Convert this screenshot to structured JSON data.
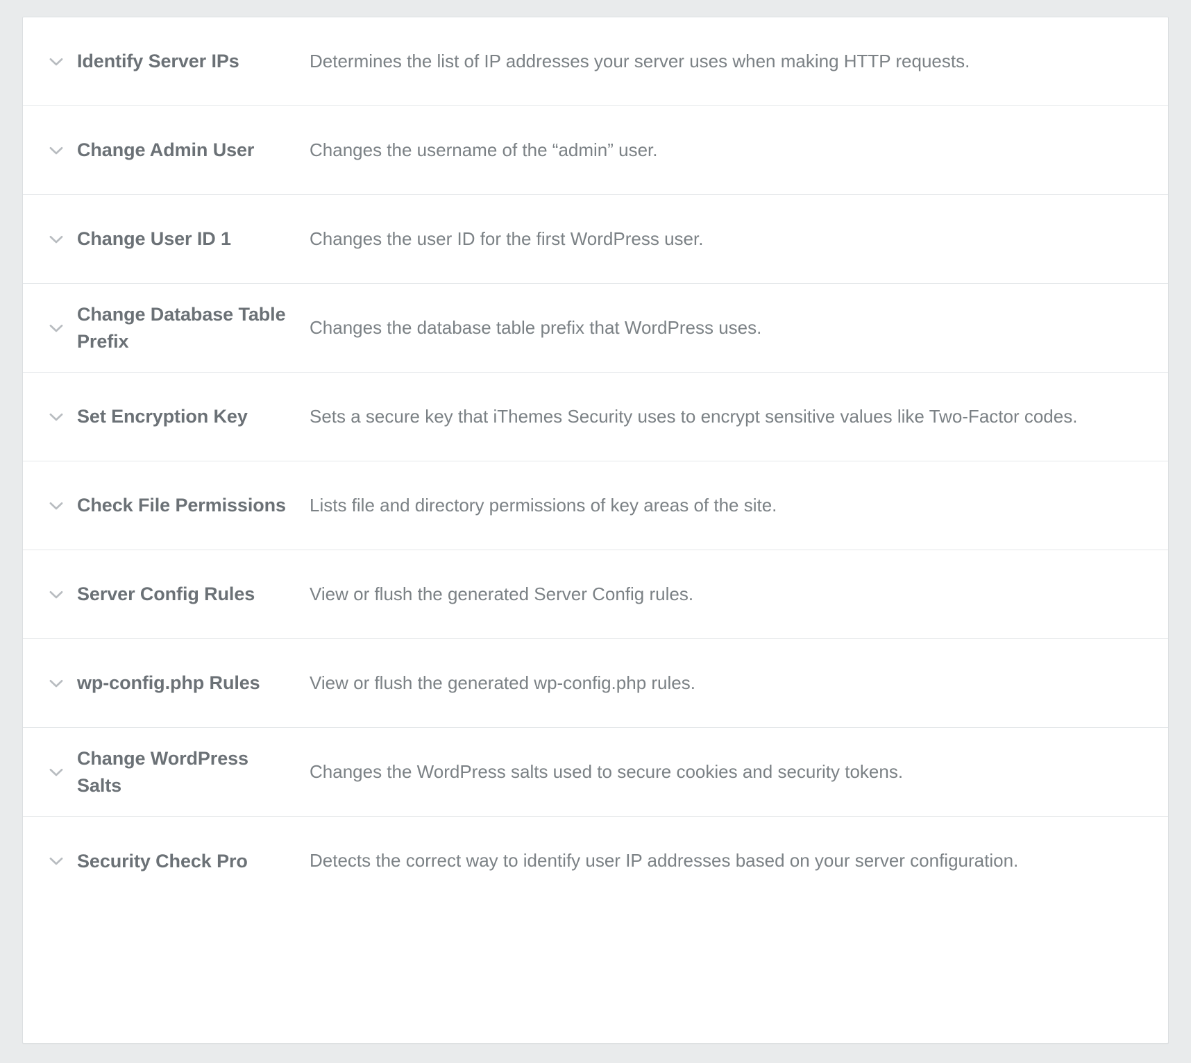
{
  "card": {
    "icon_name": "chevron-down-icon",
    "colors": {
      "page_background": "#e9ebec",
      "card_background": "#ffffff",
      "row_divider": "#e4e7e9",
      "title_text": "#6b7176",
      "description_text": "#7b8185",
      "chevron": "#b8bcc0"
    }
  },
  "tools": [
    {
      "title": "Identify Server IPs",
      "description": "Determines the list of IP addresses your server uses when making HTTP requests."
    },
    {
      "title": "Change Admin User",
      "description": "Changes the username of the “admin” user."
    },
    {
      "title": "Change User ID 1",
      "description": "Changes the user ID for the first WordPress user."
    },
    {
      "title": "Change Database Table Prefix",
      "description": "Changes the database table prefix that WordPress uses."
    },
    {
      "title": "Set Encryption Key",
      "description": "Sets a secure key that iThemes Security uses to encrypt sensitive values like Two-Factor codes."
    },
    {
      "title": "Check File Permissions",
      "description": "Lists file and directory permissions of key areas of the site."
    },
    {
      "title": "Server Config Rules",
      "description": "View or flush the generated Server Config rules."
    },
    {
      "title": "wp-config.php Rules",
      "description": "View or flush the generated wp-config.php rules."
    },
    {
      "title": "Change WordPress Salts",
      "description": "Changes the WordPress salts used to secure cookies and security tokens."
    },
    {
      "title": "Security Check Pro",
      "description": "Detects the correct way to identify user IP addresses based on your server configuration."
    }
  ]
}
